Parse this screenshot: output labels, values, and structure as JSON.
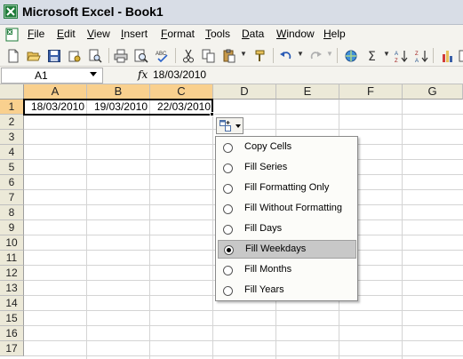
{
  "window": {
    "title": "Microsoft Excel - Book1"
  },
  "menu": [
    {
      "label": "File",
      "underline": "F",
      "rest": "ile"
    },
    {
      "label": "Edit",
      "underline": "E",
      "rest": "dit"
    },
    {
      "label": "View",
      "underline": "V",
      "rest": "iew"
    },
    {
      "label": "Insert",
      "underline": "I",
      "rest": "nsert"
    },
    {
      "label": "Format",
      "underline": "F",
      "rest": "ormat"
    },
    {
      "label": "Tools",
      "underline": "T",
      "rest": "ools"
    },
    {
      "label": "Data",
      "underline": "D",
      "rest": "ata"
    },
    {
      "label": "Window",
      "underline": "W",
      "rest": "indow"
    },
    {
      "label": "Help",
      "underline": "H",
      "rest": "elp"
    }
  ],
  "toolbar": {
    "icons": [
      "new-icon",
      "open-icon",
      "save-icon",
      "permission-icon",
      "print-icon",
      "print-preview-icon",
      "spelling-icon",
      "cut-icon",
      "copy-icon",
      "paste-icon",
      "format-painter-icon",
      "undo-icon",
      "redo-icon",
      "hyperlink-icon",
      "autosum-icon",
      "sort-ascending-icon",
      "sort-descending-icon",
      "chart-wizard-icon"
    ]
  },
  "formula_bar": {
    "name_box": "A1",
    "fx": "fx",
    "value": "18/03/2010"
  },
  "sheet": {
    "columns": [
      "A",
      "B",
      "C",
      "D",
      "E",
      "F",
      "G"
    ],
    "rows": [
      "1",
      "2",
      "3",
      "4",
      "5",
      "6",
      "7",
      "8",
      "9",
      "10",
      "11",
      "12",
      "13",
      "14",
      "15",
      "16",
      "17"
    ],
    "cells": {
      "A1": "18/03/2010",
      "B1": "19/03/2010",
      "C1": "22/03/2010"
    }
  },
  "autofill": {
    "options": [
      {
        "label": "Copy Cells",
        "selected": false
      },
      {
        "label": "Fill Series",
        "selected": false
      },
      {
        "label": "Fill Formatting Only",
        "selected": false
      },
      {
        "label": "Fill Without Formatting",
        "selected": false
      },
      {
        "label": "Fill Days",
        "selected": false
      },
      {
        "label": "Fill Weekdays",
        "selected": true
      },
      {
        "label": "Fill Months",
        "selected": false
      },
      {
        "label": "Fill Years",
        "selected": false
      }
    ]
  },
  "colors": {
    "selected_header": "#f9d08e",
    "header": "#ece9d8",
    "chrome": "#f4f3ee",
    "excel_green": "#1e7b3a"
  }
}
